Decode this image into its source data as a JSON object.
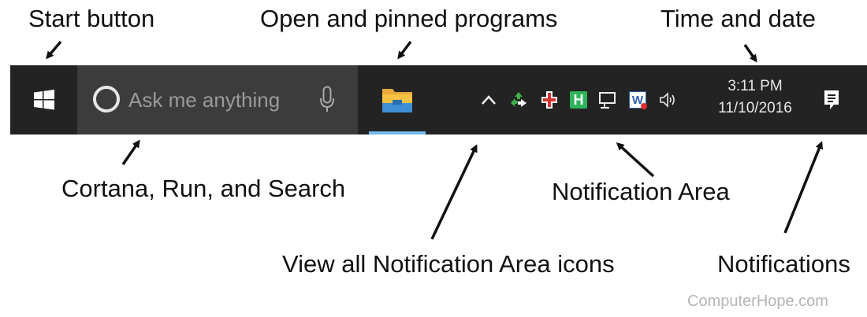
{
  "annotations": {
    "start_button": "Start button",
    "open_pinned": "Open and pinned programs",
    "time_date": "Time and date",
    "cortana": "Cortana, Run, and Search",
    "notification_area": "Notification Area",
    "view_all_icons": "View all Notification Area icons",
    "notifications": "Notifications"
  },
  "taskbar": {
    "search_placeholder": "Ask me anything",
    "time": "3:11 PM",
    "date": "11/10/2016",
    "tray_icons": [
      "show-hidden-icons-chevron",
      "recycle-icon",
      "health-cross-icon",
      "h-app-icon",
      "network-icon",
      "word-app-icon",
      "speaker-icon"
    ],
    "tray_h_letter": "H",
    "tray_w_letter": "W"
  },
  "colors": {
    "taskbar_bg": "#232323",
    "search_bg": "#3c3c3c",
    "active_underline": "#76b9ed",
    "folder_yellow": "#f5c242"
  },
  "watermark": "ComputerHope.com"
}
